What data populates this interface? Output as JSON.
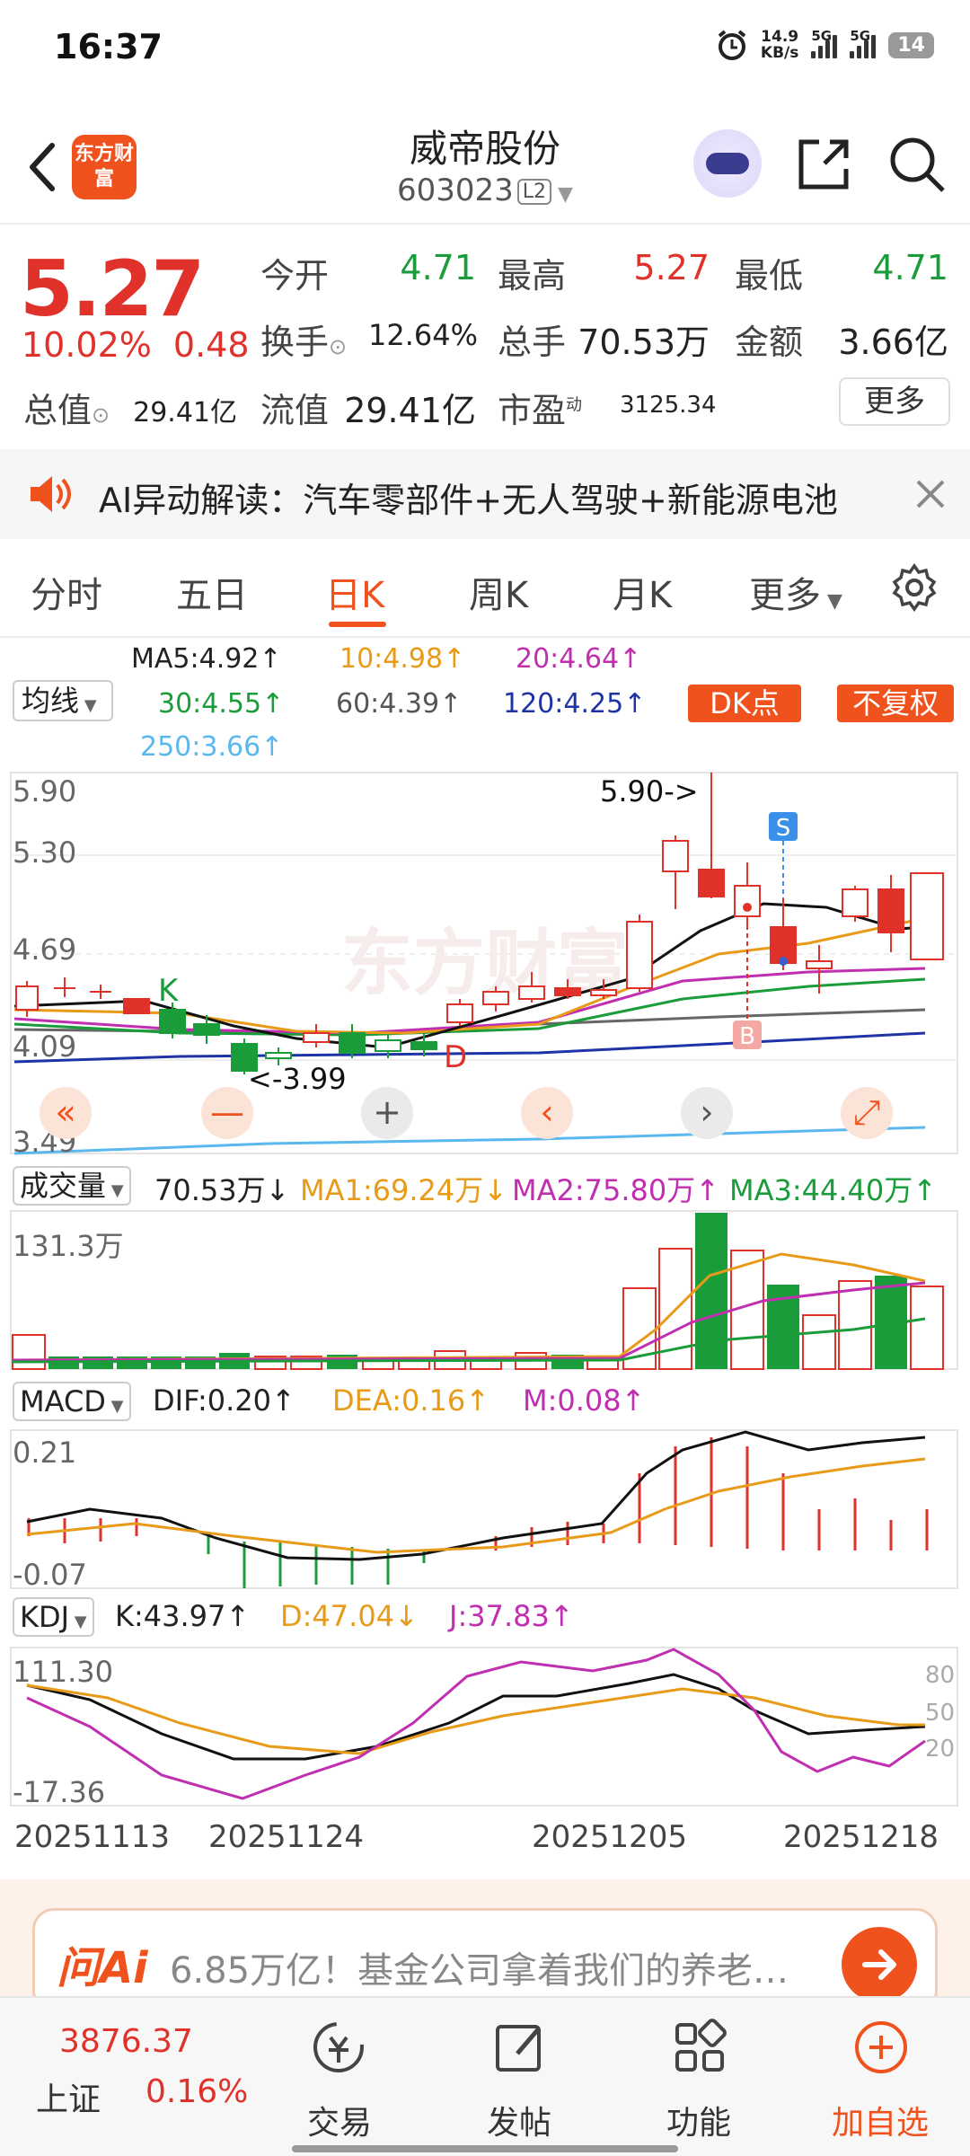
{
  "status": {
    "time": "16:37",
    "net_speed": "14.9",
    "net_unit": "KB/s",
    "sig1": "5G",
    "sig2": "5G",
    "battery": "14"
  },
  "header": {
    "logo": "东方财富",
    "name": "威帝股份",
    "code": "603023",
    "level": "L2"
  },
  "quote": {
    "price": "5.27",
    "pct": "10.02%",
    "change": "0.48",
    "open_label": "今开",
    "open": "4.71",
    "high_label": "最高",
    "high": "5.27",
    "low_label": "最低",
    "low": "4.71",
    "turnover_label": "换手",
    "turnover": "12.64%",
    "vol_label": "总手",
    "vol": "70.53万",
    "amount_label": "金额",
    "amount": "3.66亿",
    "mcap_label": "总值",
    "mcap": "29.41亿",
    "float_label": "流值",
    "float": "29.41亿",
    "pe_label": "市盈",
    "pe_sup": "动",
    "pe": "3125.34",
    "more": "更多"
  },
  "ai_bar": {
    "text": "AI异动解读：汽车零部件+无人驾驶+新能源电池"
  },
  "tabs": [
    "分时",
    "五日",
    "日K",
    "周K",
    "月K",
    "更多"
  ],
  "ma": {
    "selector": "均线",
    "ma5": "MA5:4.92↑",
    "ma10": "10:4.98↑",
    "ma20": "20:4.64↑",
    "ma30": "30:4.55↑",
    "ma60": "60:4.39↑",
    "ma120": "120:4.25↑",
    "ma250": "250:3.66↑",
    "dk_btn": "DK点",
    "fq_btn": "不复权"
  },
  "kline": {
    "y_labels": [
      "5.90",
      "5.30",
      "4.69",
      "4.09",
      "3.49"
    ],
    "high_marker": "5.90->",
    "low_marker": "<-3.99",
    "marks": {
      "K": "K",
      "D": "D",
      "S": "S",
      "B": "B"
    },
    "watermark": "东方财富"
  },
  "volume": {
    "selector": "成交量",
    "val": "70.53万↓",
    "ma1": "MA1:69.24万↓",
    "ma2": "MA2:75.80万↑",
    "ma3": "MA3:44.40万↑",
    "max": "131.3万"
  },
  "macd": {
    "selector": "MACD",
    "dif": "DIF:0.20↑",
    "dea": "DEA:0.16↑",
    "m": "M:0.08↑",
    "max": "0.21",
    "min": "-0.07"
  },
  "kdj": {
    "selector": "KDJ",
    "k": "K:43.97↑",
    "d": "D:47.04↓",
    "j": "J:37.83↑",
    "max": "111.30",
    "min": "-17.36",
    "r80": "80",
    "r50": "50",
    "r20": "20"
  },
  "dates": [
    "20251113",
    "20251124",
    "20251205",
    "20251218"
  ],
  "ad": {
    "logo": "问Ai",
    "text": "6.85万亿！基金公司拿着我们的养老…"
  },
  "bottom": {
    "index_value": "3876.37",
    "index_name": "上证",
    "index_pct": "0.16%",
    "trade": "交易",
    "post": "发帖",
    "func": "功能",
    "add": "加自选"
  },
  "colors": {
    "up": "#e0322b",
    "down": "#1a9c3a",
    "accent": "#f0521e"
  }
}
